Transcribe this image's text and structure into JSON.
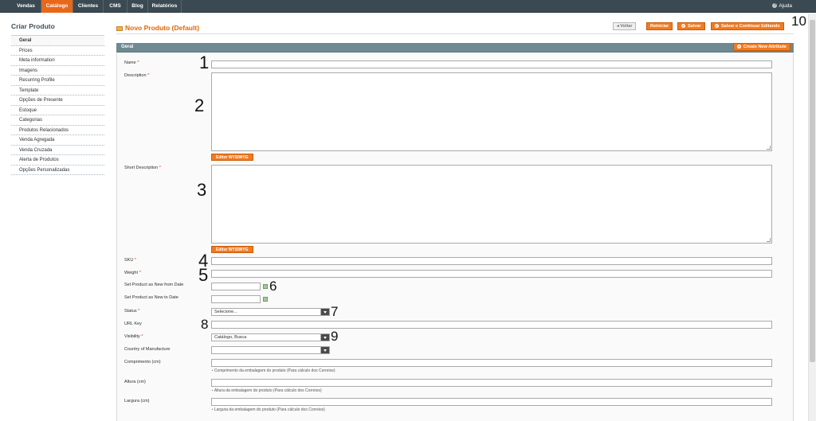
{
  "nav": {
    "items": [
      "Vendas",
      "Catálogo",
      "Clientes",
      "CMS",
      "Blog",
      "Relatórios"
    ],
    "active": "Catálogo",
    "help": "Ajuda"
  },
  "sidebar": {
    "title": "Criar Produto",
    "items": [
      "Geral",
      "Prices",
      "Meta information",
      "Imagens",
      "Recurring Profile",
      "Template",
      "Opções de Presente",
      "Estoque",
      "Categorias",
      "Produtos Relacionados",
      "Venda Agregada",
      "Venda Cruzada",
      "Alerta de Produtos",
      "Opções Personalizadas"
    ]
  },
  "header": {
    "title": "Novo Produto (Default)",
    "buttons": {
      "back": "Voltar",
      "reset": "Reiniciar",
      "save": "Salvar",
      "save_continue": "Salvar e Continuar Editando"
    }
  },
  "section": {
    "title": "Geral",
    "create_attribute": "Create New Attribute"
  },
  "form": {
    "required_mark": "*",
    "name_label": "Name",
    "description_label": "Description",
    "wysiwyg_label": "Editor WYSIWYG",
    "short_description_label": "Short Description",
    "sku_label": "SKU",
    "weight_label": "Weight",
    "new_from_label": "Set Product as New from Date",
    "new_to_label": "Set Product as New to Date",
    "status_label": "Status",
    "status_value": "Selecione...",
    "url_key_label": "URL Key",
    "visibility_label": "Visibility",
    "visibility_value": "Catálogo, Busca",
    "country_label": "Country of Manufacture",
    "country_value": "",
    "length_label": "Comprimento (cm)",
    "length_note": "Comprimento da embalagem do produto (Para cálculo dos Correios)",
    "height_label": "Altura (cm)",
    "height_note": "Altura da embalagem do produto (Para cálculo dos Correios)",
    "width_label": "Largura (cm)",
    "width_note": "Largura da embalagem do produto (Para cálculo dos Correios)"
  },
  "annotations": [
    "1",
    "2",
    "3",
    "4",
    "5",
    "6",
    "7",
    "8",
    "9",
    "10"
  ],
  "colors": {
    "accent": "#f37a1f",
    "nav_bg": "#3b4a52",
    "section_bg": "#6f8992",
    "title": "#e26703"
  }
}
